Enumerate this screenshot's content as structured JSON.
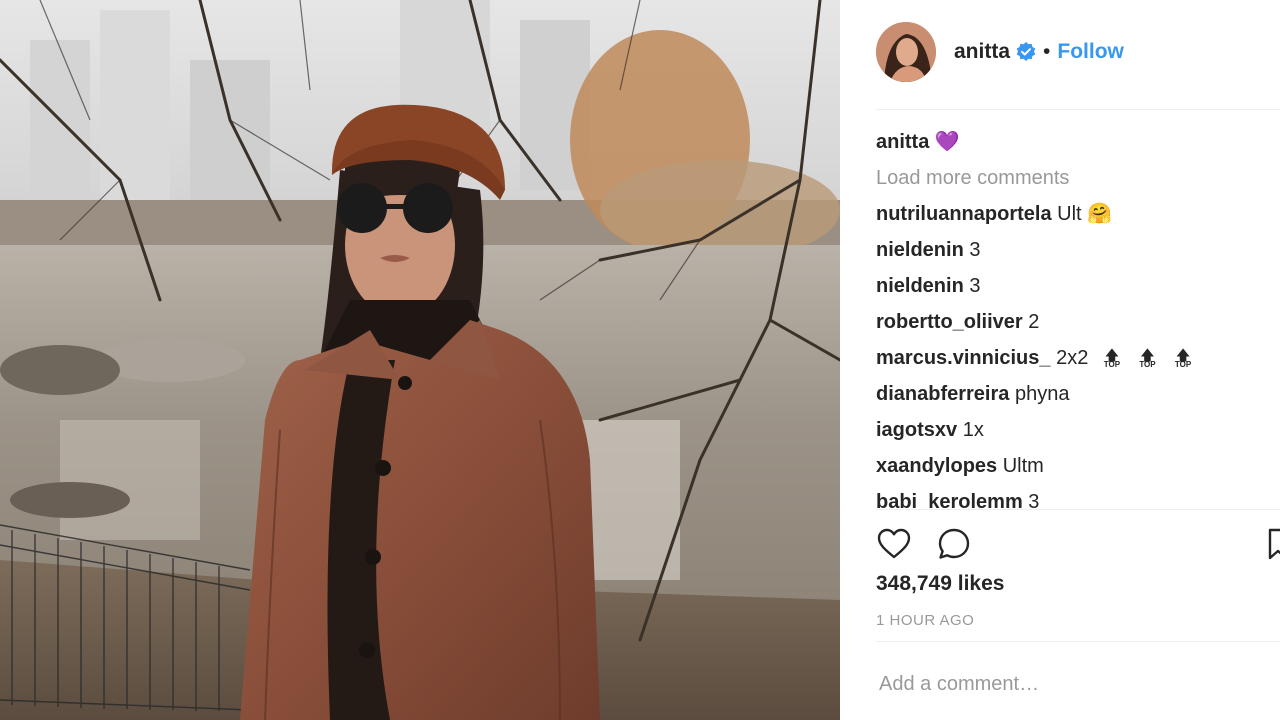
{
  "post": {
    "author": "anitta",
    "follow_label": "Follow",
    "separator": "•",
    "caption": {
      "user": "anitta",
      "text": "💜"
    },
    "load_more_label": "Load more comments",
    "comments": [
      {
        "user": "nutriluannaportela",
        "text": "Ult 🤗"
      },
      {
        "user": "nieldenin",
        "text": "3"
      },
      {
        "user": "nieldenin",
        "text": "3"
      },
      {
        "user": "robertto_oliiver",
        "text": "2"
      },
      {
        "user": "marcus.vinnicius_",
        "text": "2x2"
      },
      {
        "user": "dianabferreira",
        "text": "phyna"
      },
      {
        "user": "iagotsxv",
        "text": "1x"
      },
      {
        "user": "xaandylopes",
        "text": "Ultm"
      },
      {
        "user": "babi_kerolemm",
        "text": "3"
      }
    ],
    "top_badge": {
      "arrow": "🡅",
      "label": "TOP"
    },
    "likes_text": "348,749 likes",
    "time_text": "1 HOUR AGO",
    "add_comment_placeholder": "Add a comment…"
  },
  "colors": {
    "link": "#3897f0",
    "verified": "#3897f0",
    "muted": "#999999",
    "text": "#262626",
    "divider": "#efefef"
  },
  "icons": [
    "verified-badge-icon",
    "heart-icon",
    "comment-icon",
    "save-icon"
  ]
}
